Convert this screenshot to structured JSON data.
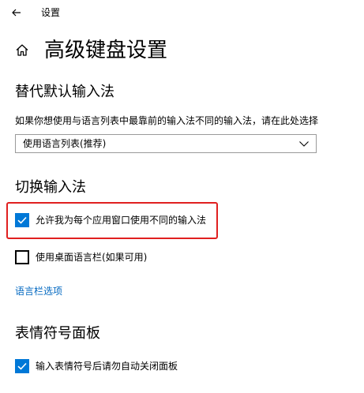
{
  "window": {
    "title": "设置",
    "back_icon": "arrow-left-icon"
  },
  "page": {
    "title": "高级键盘设置",
    "home_icon": "home-icon"
  },
  "sections": {
    "default_input": {
      "heading": "替代默认输入法",
      "description": "如果你想使用与语言列表中最靠前的输入法不同的输入法，请在此处选择",
      "dropdown_value": "使用语言列表(推荐)"
    },
    "switch_input": {
      "heading": "切换输入法",
      "per_app_checkbox": {
        "label": "允许我为每个应用窗口使用不同的输入法",
        "checked": true
      },
      "desktop_bar_checkbox": {
        "label": "使用桌面语言栏(如果可用)",
        "checked": false
      },
      "language_bar_link": "语言栏选项"
    },
    "emoji_panel": {
      "heading": "表情符号面板",
      "auto_close_checkbox": {
        "label": "输入表情符号后请勿自动关闭面板",
        "checked": true
      }
    }
  },
  "colors": {
    "accent": "#0078d7",
    "link": "#0067c0",
    "highlight": "#e02020"
  }
}
